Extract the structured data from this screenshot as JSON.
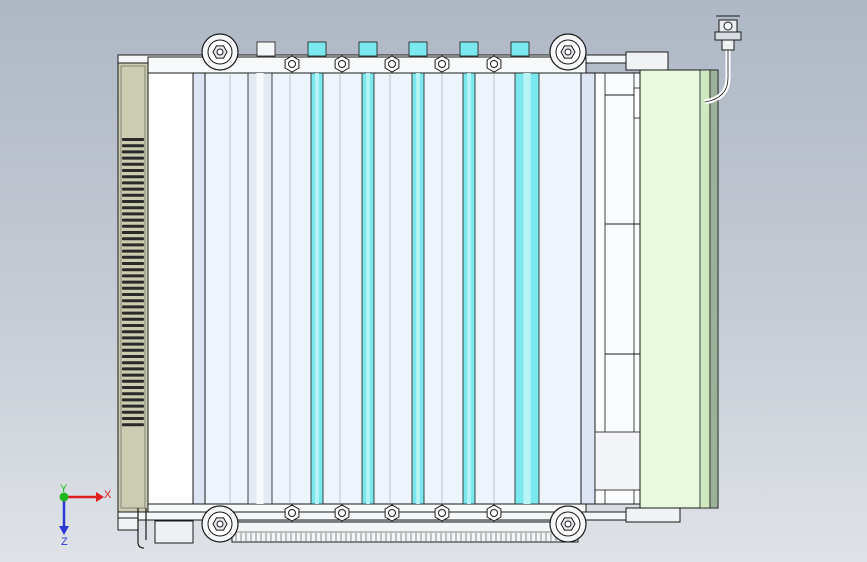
{
  "axis_triad": {
    "x_label": "X",
    "y_label": "Y",
    "z_label": "Z",
    "x_color": "#e02020",
    "y_color": "#1fb81f",
    "z_color": "#2a39d6"
  },
  "colors": {
    "background_top": "#aeb7c4",
    "background_bottom": "#dfe3e8",
    "panel_light_blue": "#eef4fc",
    "tube_cyan": "#7be7ee",
    "side_panel_green": "#e9f9dd",
    "outline": "#1a1a1a",
    "side_rail_khaki": "#ccccb0"
  },
  "icons": {
    "bolt": "hex-bolt-icon",
    "mount": "mount-ring-icon",
    "connector": "cable-connector-icon",
    "triad": "axis-triad-icon"
  }
}
